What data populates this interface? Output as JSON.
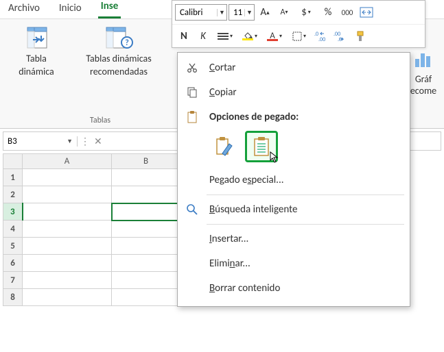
{
  "tabs": {
    "file": "Archivo",
    "home": "Inicio",
    "insert": "Inse"
  },
  "ribbon": {
    "group_label_tables": "Tablas",
    "pivot": {
      "line1": "Tabla",
      "line2": "dinámica"
    },
    "recommended": {
      "line1": "Tablas dinámicas",
      "line2": "recomendadas"
    },
    "chart_partial": {
      "line1": "Gráf",
      "line2": "ecome"
    }
  },
  "mini": {
    "font_name": "Calibri",
    "font_size": "11",
    "currency": "$",
    "percent": "%",
    "thousand": "000",
    "bold": "N",
    "italic": "K",
    "inc_dec_dec": ".00",
    "inc_dec_inc": ".0"
  },
  "namebox": {
    "ref": "B3"
  },
  "grid": {
    "cols": [
      "A",
      "B"
    ],
    "rows": [
      "1",
      "2",
      "3",
      "4",
      "5",
      "6",
      "7",
      "8"
    ]
  },
  "ctx": {
    "cut": "ortar",
    "copy": "opiar",
    "paste_head": "Opciones de pegado:",
    "paste_special": "Pegado e",
    "paste_special2": "pecial...",
    "smart": "úsqueda inteligente",
    "insert": "nsertar...",
    "delete1": "Elimi",
    "delete2": "ar...",
    "clear": "orrar contenido"
  }
}
